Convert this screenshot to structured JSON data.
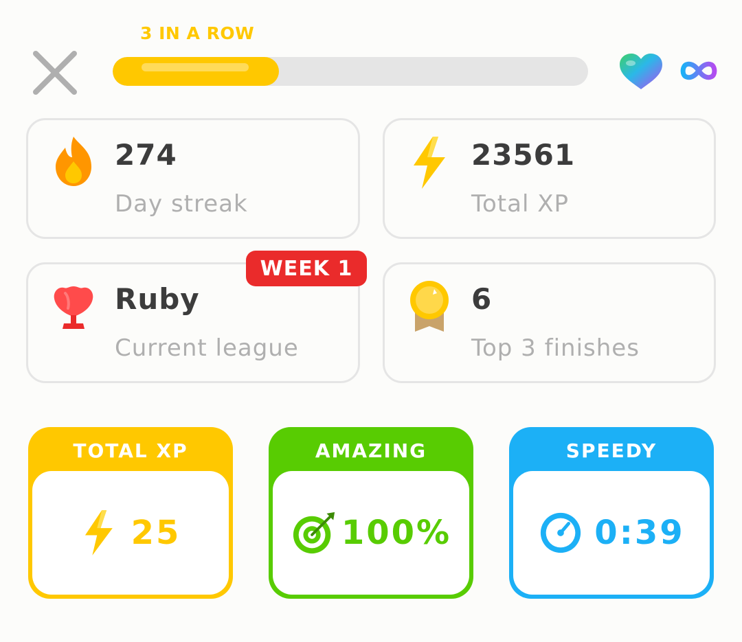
{
  "header": {
    "streak_label": "3 IN A ROW",
    "progress": 0.35,
    "close_icon": "close-icon",
    "heart_icon": "heart-icon",
    "infinity_icon": "infinity-icon"
  },
  "stats": [
    {
      "icon": "fire-icon",
      "value": "274",
      "label": "Day streak"
    },
    {
      "icon": "lightning-icon",
      "value": "23561",
      "label": "Total XP"
    },
    {
      "icon": "ruby-trophy-icon",
      "value": "Ruby",
      "label": "Current league",
      "badge": "WEEK 1"
    },
    {
      "icon": "gold-medal-icon",
      "value": "6",
      "label": "Top 3 finishes"
    }
  ],
  "results": [
    {
      "title": "TOTAL XP",
      "value": "25",
      "icon": "lightning-icon"
    },
    {
      "title": "AMAZING",
      "value": "100%",
      "icon": "target-icon"
    },
    {
      "title": "SPEEDY",
      "value": "0:39",
      "icon": "stopwatch-icon"
    }
  ],
  "colors": {
    "yellow": "#ffc800",
    "green": "#58cc02",
    "blue": "#1cb0f6",
    "red": "#ea2b2b",
    "gray_text": "#afafaf",
    "dark_text": "#3c3c3c",
    "track": "#e5e5e5"
  }
}
